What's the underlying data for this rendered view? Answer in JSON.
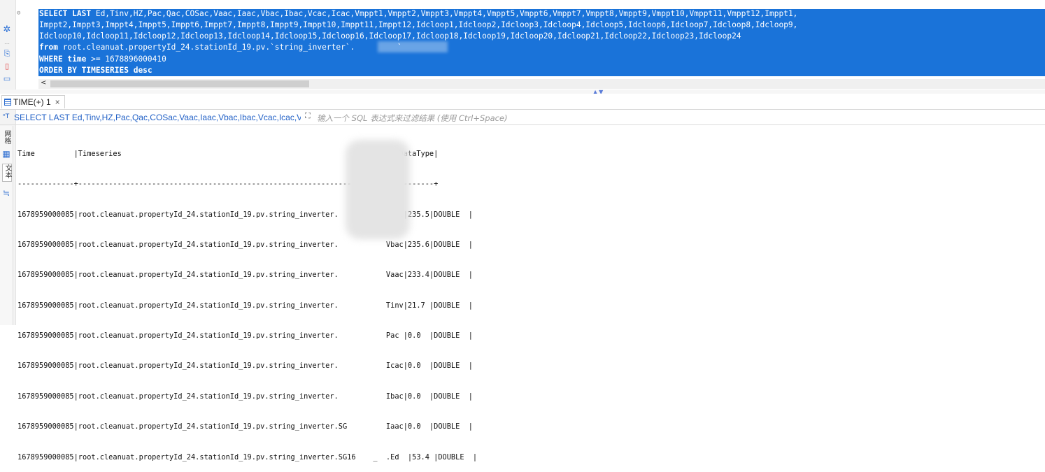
{
  "editor": {
    "sql_lines": [
      {
        "kw": "SELECT LAST",
        "text": " Ed,Tinv,HZ,Pac,Qac,COSac,Vaac,Iaac,Vbac,Ibac,Vcac,Icac,Vmppt1,Vmppt2,Vmppt3,Vmppt4,Vmppt5,Vmppt6,Vmppt7,Vmppt8,Vmppt9,Vmppt10,Vmppt11,Vmppt12,Imppt1,"
      },
      {
        "kw": "",
        "text": "Imppt2,Imppt3,Imppt4,Imppt5,Imppt6,Imppt7,Imppt8,Imppt9,Imppt10,Imppt11,Imppt12,Idcloop1,Idcloop2,Idcloop3,Idcloop4,Idcloop5,Idcloop6,Idcloop7,Idcloop8,Idcloop9,"
      },
      {
        "kw": "",
        "text": "Idcloop10,Idcloop11,Idcloop12,Idcloop13,Idcloop14,Idcloop15,Idcloop16,Idcloop17,Idcloop18,Idcloop19,Idcloop20,Idcloop21,Idcloop22,Idcloop23,Idcloop24"
      },
      {
        "kw": "from",
        "text": " root.cleanuat.propertyId_24.stationId_19.pv.`string_inverter`.         `"
      },
      {
        "kw": "WHERE time",
        "text": " >= 1678896000410"
      },
      {
        "kw": "ORDER BY TIMESERIES desc",
        "text": ""
      }
    ],
    "scroll_left_arrow": "<"
  },
  "tab": {
    "label": "TIME(+) 1",
    "close": "×"
  },
  "filter": {
    "query": "SELECT LAST Ed,Tinv,HZ,Pac,Qac,COSac,Vaac,Iaac,Vbac,Ibac,Vcac,Icac,V",
    "placeholder": "输入一个 SQL 表达式来过滤结果 (使用 Ctrl+Space)"
  },
  "side_tabs": {
    "grid": "网格",
    "text": "文本"
  },
  "result": {
    "lines": [
      "Time         |Timeseries                                                         |Value|DataType|",
      "-------------+-------------------------------------------------------------------+-----+--------+",
      "1678959000085|root.cleanuat.propertyId_24.stationId_19.pv.string_inverter.      X    Vcac|235.5|DOUBLE  |",
      "1678959000085|root.cleanuat.propertyId_24.stationId_19.pv.string_inverter.           Vbac|235.6|DOUBLE  |",
      "1678959000085|root.cleanuat.propertyId_24.stationId_19.pv.string_inverter.           Vaac|233.4|DOUBLE  |",
      "1678959000085|root.cleanuat.propertyId_24.stationId_19.pv.string_inverter.           Tinv|21.7 |DOUBLE  |",
      "1678959000085|root.cleanuat.propertyId_24.stationId_19.pv.string_inverter.           Pac |0.0  |DOUBLE  |",
      "1678959000085|root.cleanuat.propertyId_24.stationId_19.pv.string_inverter.           Icac|0.0  |DOUBLE  |",
      "1678959000085|root.cleanuat.propertyId_24.stationId_19.pv.string_inverter.           Ibac|0.0  |DOUBLE  |",
      "1678959000085|root.cleanuat.propertyId_24.stationId_19.pv.string_inverter.SG         Iaac|0.0  |DOUBLE  |",
      "1678959000085|root.cleanuat.propertyId_24.stationId_19.pv.string_inverter.SG16    _  .Ed  |53.4 |DOUBLE  |"
    ]
  }
}
